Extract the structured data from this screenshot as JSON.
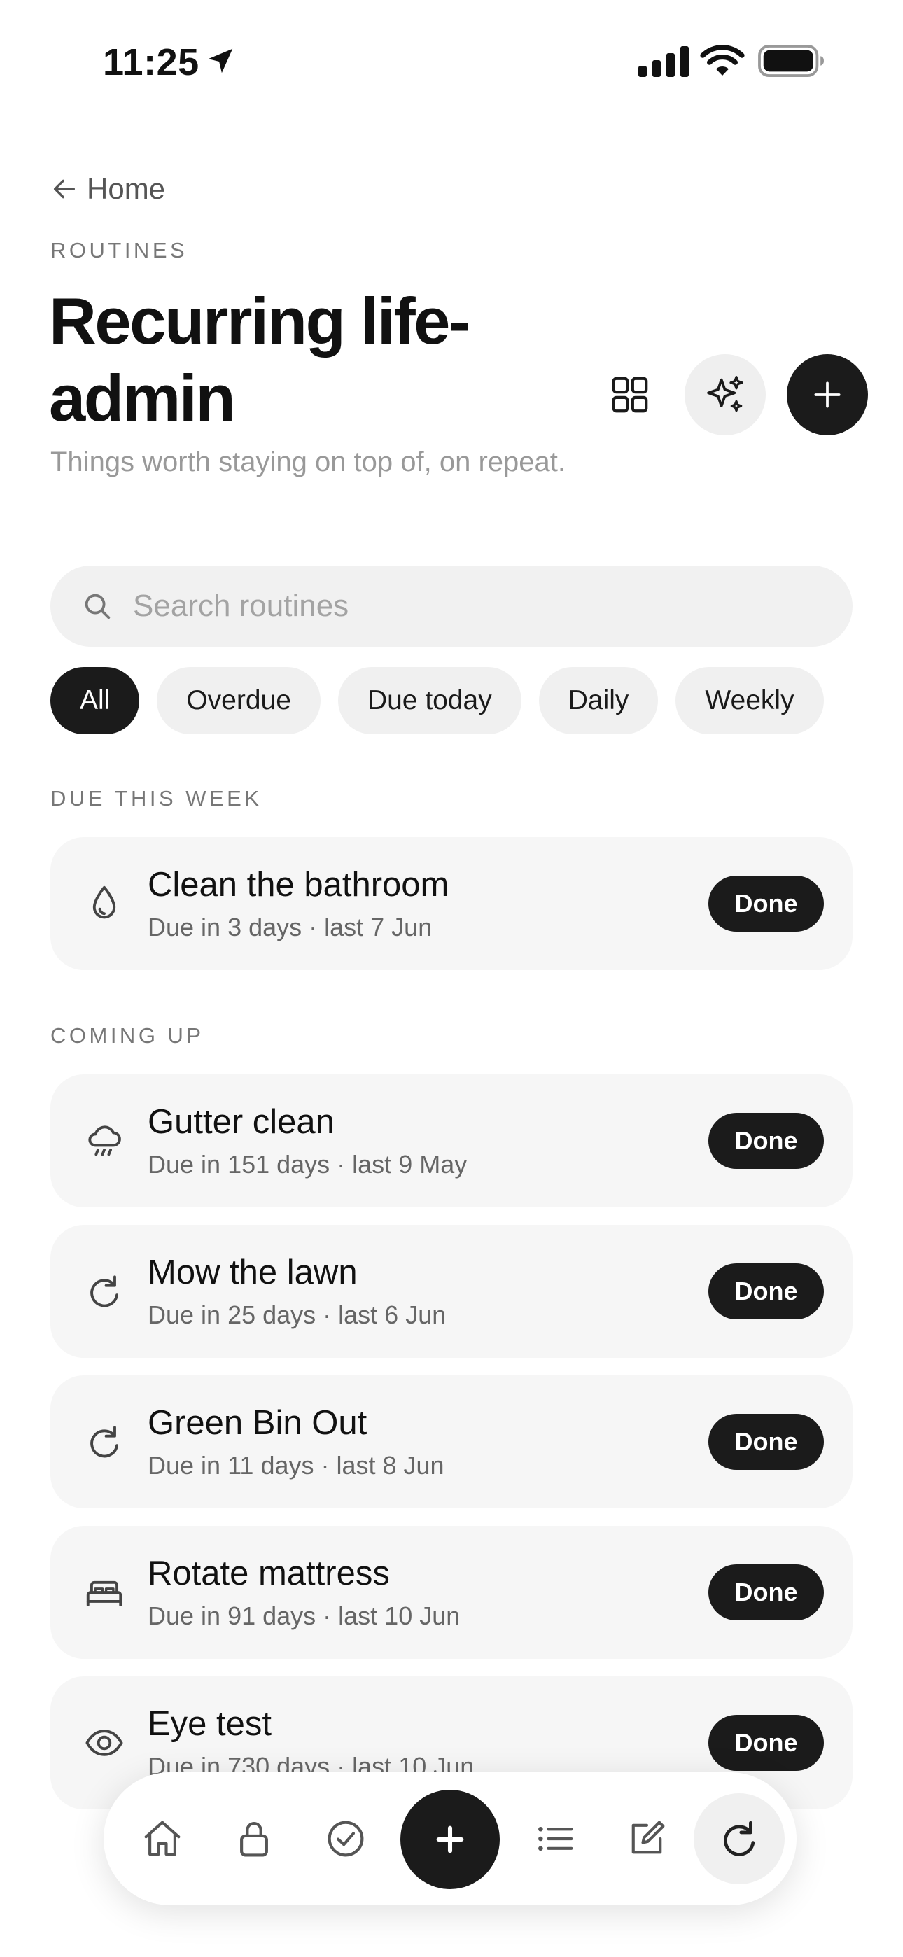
{
  "status_bar": {
    "time": "11:25"
  },
  "nav": {
    "back_label": "Home"
  },
  "header": {
    "eyebrow": "ROUTINES",
    "title": "Recurring life-admin",
    "subtitle": "Things worth staying on top of, on repeat."
  },
  "search": {
    "placeholder": "Search routines",
    "value": ""
  },
  "filters": [
    {
      "label": "All",
      "active": true
    },
    {
      "label": "Overdue",
      "active": false
    },
    {
      "label": "Due today",
      "active": false
    },
    {
      "label": "Daily",
      "active": false
    },
    {
      "label": "Weekly",
      "active": false
    }
  ],
  "sections": {
    "due_this_week": {
      "label": "DUE THIS WEEK",
      "items": [
        {
          "icon": "water-drop-icon",
          "title": "Clean the bathroom",
          "meta": "Due in 3 days · last 7 Jun",
          "action": "Done"
        }
      ]
    },
    "coming_up": {
      "label": "COMING UP",
      "items": [
        {
          "icon": "rain-cloud-icon",
          "title": "Gutter clean",
          "meta": "Due in 151 days · last 9 May",
          "action": "Done"
        },
        {
          "icon": "refresh-icon",
          "title": "Mow the lawn",
          "meta": "Due in 25 days · last 6 Jun",
          "action": "Done"
        },
        {
          "icon": "refresh-icon",
          "title": "Green Bin Out",
          "meta": "Due in 11 days · last 8 Jun",
          "action": "Done"
        },
        {
          "icon": "bed-icon",
          "title": "Rotate mattress",
          "meta": "Due in 91 days · last 10 Jun",
          "action": "Done"
        },
        {
          "icon": "eye-icon",
          "title": "Eye test",
          "meta": "Due in 730 days · last 10 Jun",
          "action": "Done"
        }
      ]
    }
  },
  "tab_bar": {
    "items": [
      "home-icon",
      "lock-icon",
      "check-circle-icon",
      "plus-icon",
      "list-icon",
      "edit-icon",
      "refresh-icon"
    ],
    "active": "refresh-icon"
  },
  "colors": {
    "accent": "#1b1b1b",
    "card_bg": "#f6f6f6",
    "chip_bg": "#f0f0f0"
  }
}
